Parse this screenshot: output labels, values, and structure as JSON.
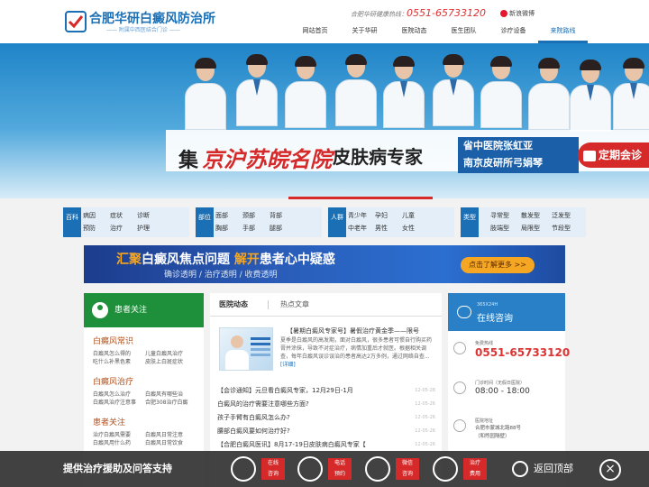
{
  "header": {
    "logo_title": "合肥华研白癜风防治所",
    "logo_sub": "—— 附属中西医结合门诊 ——",
    "hotline_label": "合肥华研健康热线：",
    "hotline_number": "0551-65733120",
    "weibo_label": "新浪微博",
    "nav": [
      "网站首页",
      "关于华研",
      "医院动态",
      "医生团队",
      "诊疗设备",
      "来院路线"
    ]
  },
  "banner": {
    "ji": "集",
    "cities": "京沪苏皖名院",
    "skin": "皮肤病专家",
    "hospital_line1": "省中医院张虹亚",
    "hospital_line2": "南京皮研所弓娟琴",
    "meeting": "定期会诊"
  },
  "categories": [
    {
      "label": "百科",
      "links": [
        "病因",
        "症状",
        "诊断",
        "预防",
        "治疗",
        "护理"
      ]
    },
    {
      "label": "部位",
      "links": [
        "面部",
        "颈部",
        "背部",
        "胸部",
        "手部",
        "腿部"
      ]
    },
    {
      "label": "人群",
      "links": [
        "青少年",
        "孕妇",
        "儿童",
        "中老年",
        "男性",
        "女性"
      ]
    },
    {
      "label": "类型",
      "links": [
        "寻常型",
        "散发型",
        "泛发型",
        "肢端型",
        "局限型",
        "节段型"
      ]
    }
  ],
  "ad": {
    "part1": "汇聚",
    "part2": "白癜风焦点问题",
    "part3": "解开",
    "part4": "患者心中疑惑",
    "sub": "确诊透明 / 治疗透明 / 收费透明",
    "button": "点击了解更多 >>"
  },
  "left": {
    "header": "患者关注",
    "sections": [
      {
        "title": "白癜风常识",
        "links": [
          "白癜风怎么得的",
          "儿童白癜风治疗",
          "吃什么补黑色素",
          "皮肤上白斑症状"
        ]
      },
      {
        "title": "白癜风治疗",
        "links": [
          "白癜风怎么治疗",
          "白癜风有哪些治",
          "白癜风治疗注意事",
          "合肥308治疗白癜"
        ]
      },
      {
        "title": "患者关注",
        "links": [
          "治疗白癜风需要",
          "白癜风日常注意",
          "白癜风用什么药",
          "白癜风日常饮食"
        ]
      }
    ]
  },
  "middle": {
    "tabs": [
      "医院动态",
      "热点文章"
    ],
    "featured_title": "【暑期白癜风专家号】暑假治疗黄金季——限号",
    "featured_body": "夏季是白癜风的高发期，面对白癜风，很多患者可惯自行购买药膏并涂抹，导致不对症治疗，病情加重后才就医。根据相关调查，每年白癜风误诊误治的患者高达2万多例，通过网络自查...",
    "featured_more": "[详细]",
    "news": [
      {
        "title": "【会诊通知】元旦看白癜风专家，12月29日-1月",
        "date": "12-05-28"
      },
      {
        "title": "白癜风的治疗需要注意哪些方面?",
        "date": "12-05-26"
      },
      {
        "title": "孩子手臂有白癜风怎么办?",
        "date": "12-05-26"
      },
      {
        "title": "腰部白癜风要如何治疗好?",
        "date": "12-05-26"
      },
      {
        "title": "【合肥白癜风医讯】8月17-19日皮肤病白癜风专家【",
        "date": "12-05-26"
      }
    ]
  },
  "right": {
    "head_small": "365X24H",
    "head_large": "在线咨询",
    "phone_label": "免费热线",
    "phone": "0551-65733120",
    "hours_label": "门诊时间（无假日医院）",
    "hours": "08:00 - 18:00",
    "addr_label": "医院地址",
    "addr_line1": "合肥市蒙城北路88号",
    "addr_line2": "（和煦园隔壁）"
  },
  "bottom": {
    "text": "提供治疗援助及问答支持",
    "buttons": [
      {
        "icon": "headset-icon",
        "label": "在线\n咨询"
      },
      {
        "icon": "phone-icon",
        "label": "电话\n预约"
      },
      {
        "icon": "wechat-icon",
        "label": "微信\n咨询"
      },
      {
        "icon": "money-icon",
        "label": "治疗\n费用"
      }
    ],
    "back_top": "返回顶部"
  }
}
